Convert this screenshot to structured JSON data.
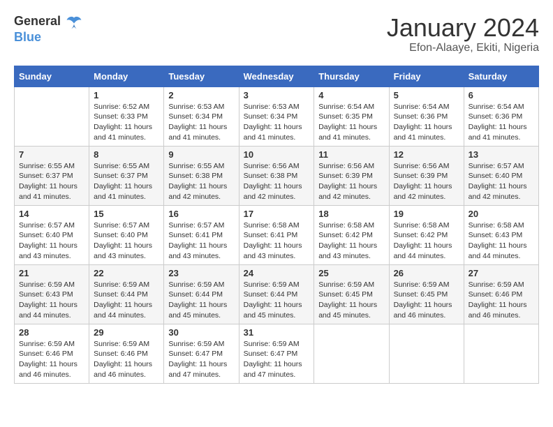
{
  "header": {
    "logo_general": "General",
    "logo_blue": "Blue",
    "month_title": "January 2024",
    "location": "Efon-Alaaye, Ekiti, Nigeria"
  },
  "weekdays": [
    "Sunday",
    "Monday",
    "Tuesday",
    "Wednesday",
    "Thursday",
    "Friday",
    "Saturday"
  ],
  "weeks": [
    [
      {
        "day": "",
        "sunrise": "",
        "sunset": "",
        "daylight": ""
      },
      {
        "day": "1",
        "sunrise": "Sunrise: 6:52 AM",
        "sunset": "Sunset: 6:33 PM",
        "daylight": "Daylight: 11 hours and 41 minutes."
      },
      {
        "day": "2",
        "sunrise": "Sunrise: 6:53 AM",
        "sunset": "Sunset: 6:34 PM",
        "daylight": "Daylight: 11 hours and 41 minutes."
      },
      {
        "day": "3",
        "sunrise": "Sunrise: 6:53 AM",
        "sunset": "Sunset: 6:34 PM",
        "daylight": "Daylight: 11 hours and 41 minutes."
      },
      {
        "day": "4",
        "sunrise": "Sunrise: 6:54 AM",
        "sunset": "Sunset: 6:35 PM",
        "daylight": "Daylight: 11 hours and 41 minutes."
      },
      {
        "day": "5",
        "sunrise": "Sunrise: 6:54 AM",
        "sunset": "Sunset: 6:36 PM",
        "daylight": "Daylight: 11 hours and 41 minutes."
      },
      {
        "day": "6",
        "sunrise": "Sunrise: 6:54 AM",
        "sunset": "Sunset: 6:36 PM",
        "daylight": "Daylight: 11 hours and 41 minutes."
      }
    ],
    [
      {
        "day": "7",
        "sunrise": "Sunrise: 6:55 AM",
        "sunset": "Sunset: 6:37 PM",
        "daylight": "Daylight: 11 hours and 41 minutes."
      },
      {
        "day": "8",
        "sunrise": "Sunrise: 6:55 AM",
        "sunset": "Sunset: 6:37 PM",
        "daylight": "Daylight: 11 hours and 41 minutes."
      },
      {
        "day": "9",
        "sunrise": "Sunrise: 6:55 AM",
        "sunset": "Sunset: 6:38 PM",
        "daylight": "Daylight: 11 hours and 42 minutes."
      },
      {
        "day": "10",
        "sunrise": "Sunrise: 6:56 AM",
        "sunset": "Sunset: 6:38 PM",
        "daylight": "Daylight: 11 hours and 42 minutes."
      },
      {
        "day": "11",
        "sunrise": "Sunrise: 6:56 AM",
        "sunset": "Sunset: 6:39 PM",
        "daylight": "Daylight: 11 hours and 42 minutes."
      },
      {
        "day": "12",
        "sunrise": "Sunrise: 6:56 AM",
        "sunset": "Sunset: 6:39 PM",
        "daylight": "Daylight: 11 hours and 42 minutes."
      },
      {
        "day": "13",
        "sunrise": "Sunrise: 6:57 AM",
        "sunset": "Sunset: 6:40 PM",
        "daylight": "Daylight: 11 hours and 42 minutes."
      }
    ],
    [
      {
        "day": "14",
        "sunrise": "Sunrise: 6:57 AM",
        "sunset": "Sunset: 6:40 PM",
        "daylight": "Daylight: 11 hours and 43 minutes."
      },
      {
        "day": "15",
        "sunrise": "Sunrise: 6:57 AM",
        "sunset": "Sunset: 6:40 PM",
        "daylight": "Daylight: 11 hours and 43 minutes."
      },
      {
        "day": "16",
        "sunrise": "Sunrise: 6:57 AM",
        "sunset": "Sunset: 6:41 PM",
        "daylight": "Daylight: 11 hours and 43 minutes."
      },
      {
        "day": "17",
        "sunrise": "Sunrise: 6:58 AM",
        "sunset": "Sunset: 6:41 PM",
        "daylight": "Daylight: 11 hours and 43 minutes."
      },
      {
        "day": "18",
        "sunrise": "Sunrise: 6:58 AM",
        "sunset": "Sunset: 6:42 PM",
        "daylight": "Daylight: 11 hours and 43 minutes."
      },
      {
        "day": "19",
        "sunrise": "Sunrise: 6:58 AM",
        "sunset": "Sunset: 6:42 PM",
        "daylight": "Daylight: 11 hours and 44 minutes."
      },
      {
        "day": "20",
        "sunrise": "Sunrise: 6:58 AM",
        "sunset": "Sunset: 6:43 PM",
        "daylight": "Daylight: 11 hours and 44 minutes."
      }
    ],
    [
      {
        "day": "21",
        "sunrise": "Sunrise: 6:59 AM",
        "sunset": "Sunset: 6:43 PM",
        "daylight": "Daylight: 11 hours and 44 minutes."
      },
      {
        "day": "22",
        "sunrise": "Sunrise: 6:59 AM",
        "sunset": "Sunset: 6:44 PM",
        "daylight": "Daylight: 11 hours and 44 minutes."
      },
      {
        "day": "23",
        "sunrise": "Sunrise: 6:59 AM",
        "sunset": "Sunset: 6:44 PM",
        "daylight": "Daylight: 11 hours and 45 minutes."
      },
      {
        "day": "24",
        "sunrise": "Sunrise: 6:59 AM",
        "sunset": "Sunset: 6:44 PM",
        "daylight": "Daylight: 11 hours and 45 minutes."
      },
      {
        "day": "25",
        "sunrise": "Sunrise: 6:59 AM",
        "sunset": "Sunset: 6:45 PM",
        "daylight": "Daylight: 11 hours and 45 minutes."
      },
      {
        "day": "26",
        "sunrise": "Sunrise: 6:59 AM",
        "sunset": "Sunset: 6:45 PM",
        "daylight": "Daylight: 11 hours and 46 minutes."
      },
      {
        "day": "27",
        "sunrise": "Sunrise: 6:59 AM",
        "sunset": "Sunset: 6:46 PM",
        "daylight": "Daylight: 11 hours and 46 minutes."
      }
    ],
    [
      {
        "day": "28",
        "sunrise": "Sunrise: 6:59 AM",
        "sunset": "Sunset: 6:46 PM",
        "daylight": "Daylight: 11 hours and 46 minutes."
      },
      {
        "day": "29",
        "sunrise": "Sunrise: 6:59 AM",
        "sunset": "Sunset: 6:46 PM",
        "daylight": "Daylight: 11 hours and 46 minutes."
      },
      {
        "day": "30",
        "sunrise": "Sunrise: 6:59 AM",
        "sunset": "Sunset: 6:47 PM",
        "daylight": "Daylight: 11 hours and 47 minutes."
      },
      {
        "day": "31",
        "sunrise": "Sunrise: 6:59 AM",
        "sunset": "Sunset: 6:47 PM",
        "daylight": "Daylight: 11 hours and 47 minutes."
      },
      {
        "day": "",
        "sunrise": "",
        "sunset": "",
        "daylight": ""
      },
      {
        "day": "",
        "sunrise": "",
        "sunset": "",
        "daylight": ""
      },
      {
        "day": "",
        "sunrise": "",
        "sunset": "",
        "daylight": ""
      }
    ]
  ]
}
